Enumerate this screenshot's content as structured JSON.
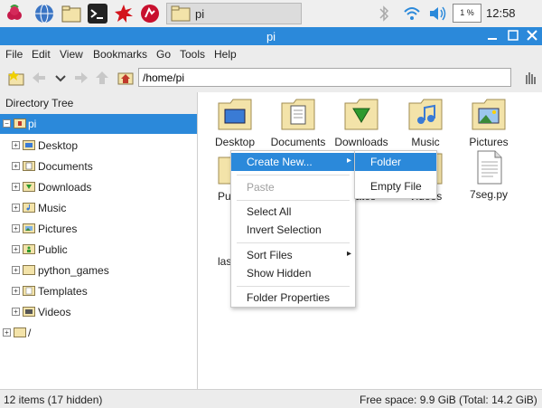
{
  "taskbar": {
    "window_title": "pi",
    "cpu": "1 %",
    "clock": "12:58"
  },
  "window": {
    "title": "pi"
  },
  "menu": [
    "File",
    "Edit",
    "View",
    "Bookmarks",
    "Go",
    "Tools",
    "Help"
  ],
  "location": {
    "path": "/home/pi"
  },
  "sidebar": {
    "header": "Directory Tree",
    "root": "pi",
    "items": [
      "Desktop",
      "Documents",
      "Downloads",
      "Music",
      "Pictures",
      "Public",
      "python_games",
      "Templates",
      "Videos"
    ],
    "fs_root": "/"
  },
  "files": {
    "row1": [
      "Desktop",
      "Documents",
      "Downloads",
      "Music",
      "Pictures"
    ],
    "pub": "Pu",
    "templates": "plates",
    "videos": "Videos",
    "seg": "7seg.py",
    "las": "las"
  },
  "context_menu": {
    "create_new": "Create New...",
    "paste": "Paste",
    "select_all": "Select All",
    "invert_selection": "Invert Selection",
    "sort_files": "Sort Files",
    "show_hidden": "Show Hidden",
    "folder_properties": "Folder Properties"
  },
  "submenu": {
    "folder": "Folder",
    "empty_file": "Empty File"
  },
  "status": {
    "items": "12 items (17 hidden)",
    "free_space": "Free space: 9.9 GiB (Total: 14.2 GiB)"
  },
  "colors": {
    "accent": "#2b89da",
    "folder": "#f3e3a9",
    "folder_border": "#a08c52"
  }
}
